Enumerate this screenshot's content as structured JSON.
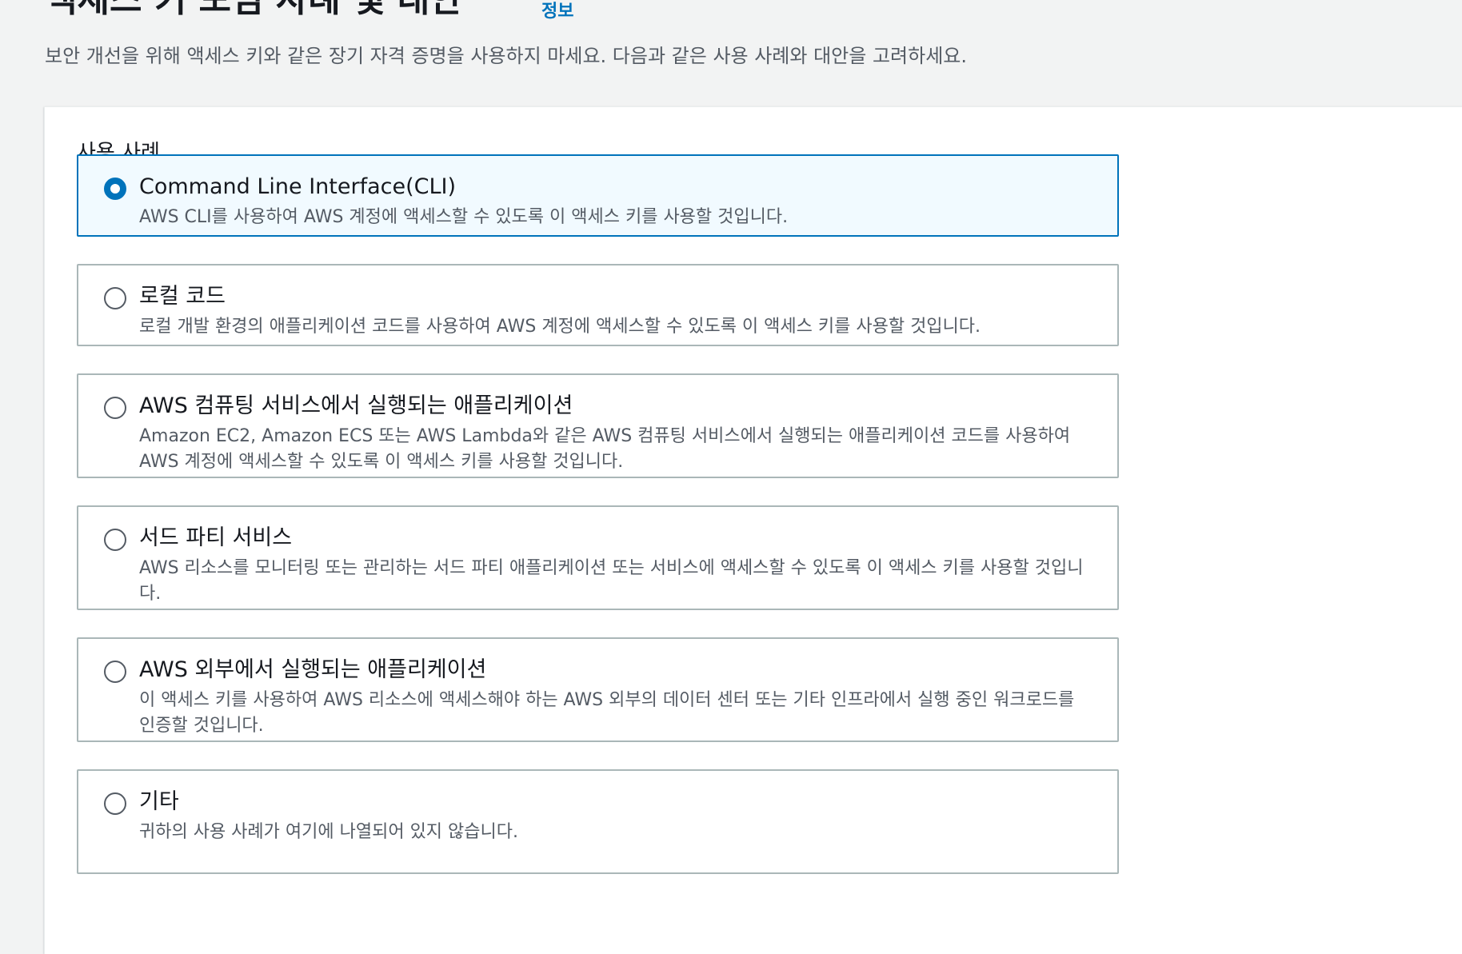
{
  "header": {
    "title": "액세스 키 모범 사례 및 대안",
    "info_link": "정보",
    "description": "보안 개선을 위해 액세스 키와 같은 장기 자격 증명을 사용하지 마세요. 다음과 같은 사용 사례와 대안을 고려하세요."
  },
  "use_cases": {
    "label": "사용 사례",
    "selected": "Command Line Interface(CLI)",
    "options": [
      {
        "title": "Command Line Interface(CLI)",
        "description": "AWS CLI를 사용하여 AWS 계정에 액세스할 수 있도록 이 액세스 키를 사용할 것입니다."
      },
      {
        "title": "로컬 코드",
        "description": "로컬 개발 환경의 애플리케이션 코드를 사용하여 AWS 계정에 액세스할 수 있도록 이 액세스 키를 사용할 것입니다."
      },
      {
        "title": "AWS 컴퓨팅 서비스에서 실행되는 애플리케이션",
        "description": "Amazon EC2, Amazon ECS 또는 AWS Lambda와 같은 AWS 컴퓨팅 서비스에서 실행되는 애플리케이션 코드를 사용하여 AWS 계정에 액세스할 수 있도록 이 액세스 키를 사용할 것입니다."
      },
      {
        "title": "서드 파티 서비스",
        "description": "AWS 리소스를 모니터링 또는 관리하는 서드 파티 애플리케이션 또는 서비스에 액세스할 수 있도록 이 액세스 키를 사용할 것입니다."
      },
      {
        "title": "AWS 외부에서 실행되는 애플리케이션",
        "description": "이 액세스 키를 사용하여 AWS 리소스에 액세스해야 하는 AWS 외부의 데이터 센터 또는 기타 인프라에서 실행 중인 워크로드를 인증할 것입니다."
      },
      {
        "title": "기타",
        "description": "귀하의 사용 사례가 여기에 나열되어 있지 않습니다."
      }
    ]
  },
  "colors": {
    "accent": "#0073bb",
    "selected_background": "#f1faff",
    "border": "#aab7b8",
    "page_background": "#f2f3f3"
  }
}
